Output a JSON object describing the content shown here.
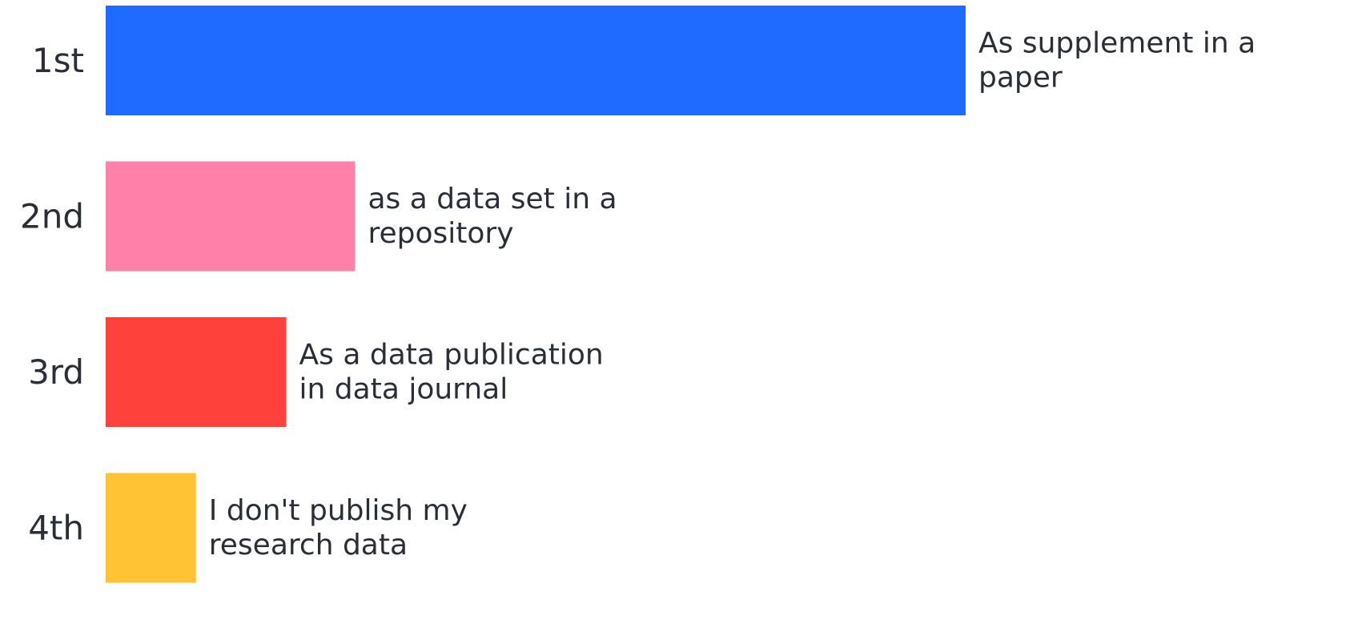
{
  "chart_data": {
    "type": "bar",
    "orientation": "horizontal",
    "categories": [
      "1st",
      "2nd",
      "3rd",
      "4th"
    ],
    "series": [
      {
        "values": [
          100,
          29,
          21,
          10.5
        ],
        "labels": [
          [
            "As supplement in a",
            "paper"
          ],
          [
            "as a data set in a",
            "repository"
          ],
          [
            "As a data publication",
            "in data journal"
          ],
          [
            "I don't publish my",
            "research data"
          ]
        ]
      }
    ],
    "colors": [
      "#1f6bff",
      "#ff80a8",
      "#ff413b",
      "#ffc333"
    ],
    "xlim": [
      0,
      100
    ],
    "grid": false,
    "legend": "none",
    "title": "",
    "xlabel": "",
    "ylabel": ""
  }
}
